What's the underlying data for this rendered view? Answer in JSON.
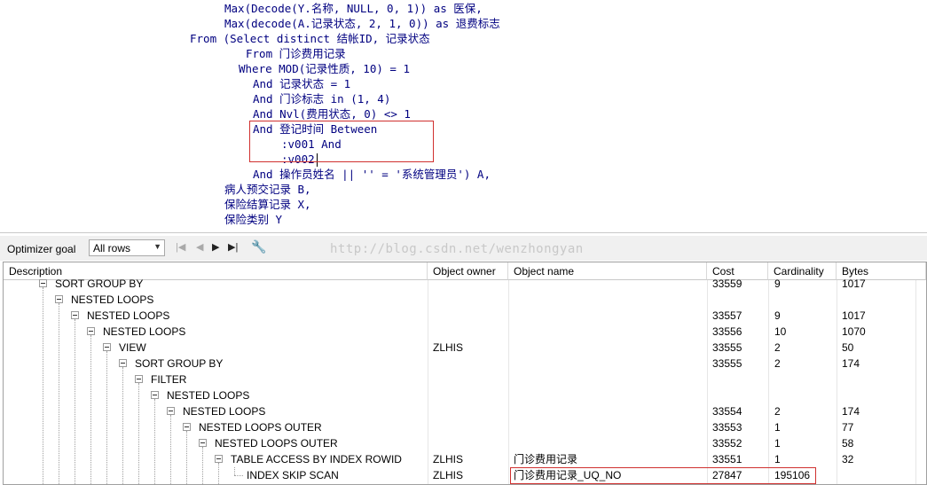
{
  "sql": {
    "lines": [
      "Max(Decode(Y.名称, NULL, 0, 1)) as 医保,",
      "Max(decode(A.记录状态, 2, 1, 0)) as 退费标志",
      "From (Select distinct 结帐ID, 记录状态",
      "From 门诊费用记录",
      "Where MOD(记录性质, 10) = 1",
      "And 记录状态 = 1",
      "And 门诊标志 in (1, 4)",
      "And Nvl(费用状态, 0) <> 1",
      "And 登记时间 Between",
      ":v001 And",
      ":v002",
      "And 操作员姓名 || '' = '系统管理员') A,",
      "病人预交记录 B,",
      "保险结算记录 X,",
      "保险类别 Y"
    ]
  },
  "toolbar": {
    "optimizer_label": "Optimizer goal",
    "optimizer_value": "All rows",
    "watermark": "http://blog.csdn.net/wenzhongyan"
  },
  "grid": {
    "columns": [
      "Description",
      "Object owner",
      "Object name",
      "Cost",
      "Cardinality",
      "Bytes"
    ],
    "rows": [
      {
        "desc": "SORT GROUP BY",
        "owner": "",
        "name": "",
        "cost": "33559",
        "card": "9",
        "bytes": "1017"
      },
      {
        "desc": "NESTED LOOPS",
        "owner": "",
        "name": "",
        "cost": "",
        "card": "",
        "bytes": ""
      },
      {
        "desc": "NESTED LOOPS",
        "owner": "",
        "name": "",
        "cost": "33557",
        "card": "9",
        "bytes": "1017"
      },
      {
        "desc": "NESTED LOOPS",
        "owner": "",
        "name": "",
        "cost": "33556",
        "card": "10",
        "bytes": "1070"
      },
      {
        "desc": "VIEW",
        "owner": "ZLHIS",
        "name": "",
        "cost": "33555",
        "card": "2",
        "bytes": "50"
      },
      {
        "desc": "SORT GROUP BY",
        "owner": "",
        "name": "",
        "cost": "33555",
        "card": "2",
        "bytes": "174"
      },
      {
        "desc": "FILTER",
        "owner": "",
        "name": "",
        "cost": "",
        "card": "",
        "bytes": ""
      },
      {
        "desc": "NESTED LOOPS",
        "owner": "",
        "name": "",
        "cost": "",
        "card": "",
        "bytes": ""
      },
      {
        "desc": "NESTED LOOPS",
        "owner": "",
        "name": "",
        "cost": "33554",
        "card": "2",
        "bytes": "174"
      },
      {
        "desc": "NESTED LOOPS OUTER",
        "owner": "",
        "name": "",
        "cost": "33553",
        "card": "1",
        "bytes": "77"
      },
      {
        "desc": "NESTED LOOPS OUTER",
        "owner": "",
        "name": "",
        "cost": "33552",
        "card": "1",
        "bytes": "58"
      },
      {
        "desc": "TABLE ACCESS BY INDEX ROWID",
        "owner": "ZLHIS",
        "name": "门诊费用记录",
        "cost": "33551",
        "card": "1",
        "bytes": "32"
      },
      {
        "desc": "INDEX SKIP SCAN",
        "owner": "ZLHIS",
        "name": "门诊费用记录_UQ_NO",
        "cost": "27847",
        "card": "195106",
        "bytes": ""
      }
    ]
  }
}
